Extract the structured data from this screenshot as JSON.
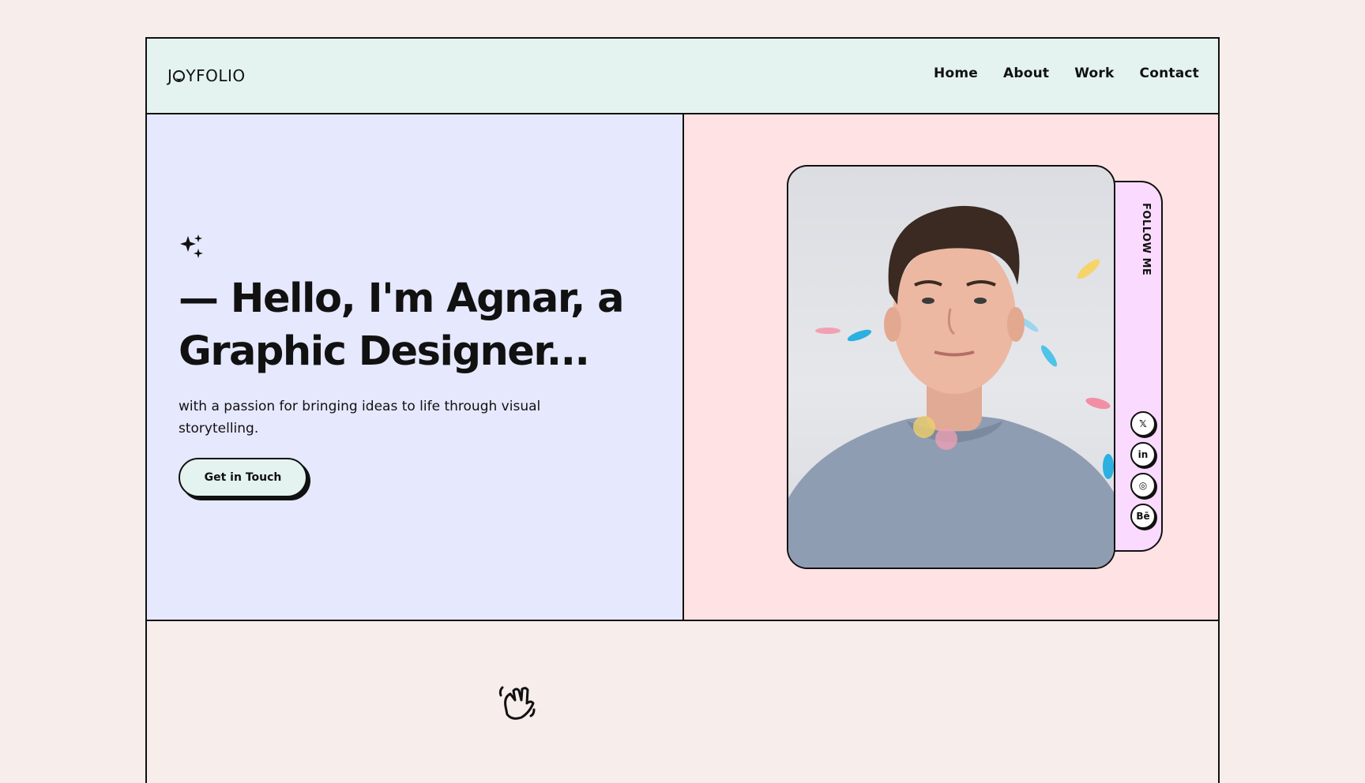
{
  "header": {
    "logo_prefix": "J",
    "logo_suffix": "YFOLIO",
    "nav": [
      "Home",
      "About",
      "Work",
      "Contact"
    ]
  },
  "hero": {
    "headline_line1": "— Hello, I'm Agnar, a",
    "headline_line2": "Graphic Designer...",
    "subtitle": "with a passion for bringing ideas to life through visual storytelling.",
    "cta_label": "Get in Touch"
  },
  "follow": {
    "label": "FOLLOW ME",
    "socials": [
      {
        "icon": "x-icon",
        "text": "𝕏"
      },
      {
        "icon": "linkedin-icon",
        "text": "in"
      },
      {
        "icon": "dribbble-icon",
        "text": "◎"
      },
      {
        "icon": "behance-icon",
        "text": "Bē"
      }
    ]
  },
  "icons": {
    "sparkle": "sparkle-icon",
    "wave": "waving-hand-icon"
  },
  "colors": {
    "page_bg": "#f7eeec",
    "header_bg": "#e4f3f0",
    "left_panel_bg": "#e6e8fd",
    "right_panel_bg": "#ffe2e4",
    "follow_tab_bg": "#fadaff"
  }
}
